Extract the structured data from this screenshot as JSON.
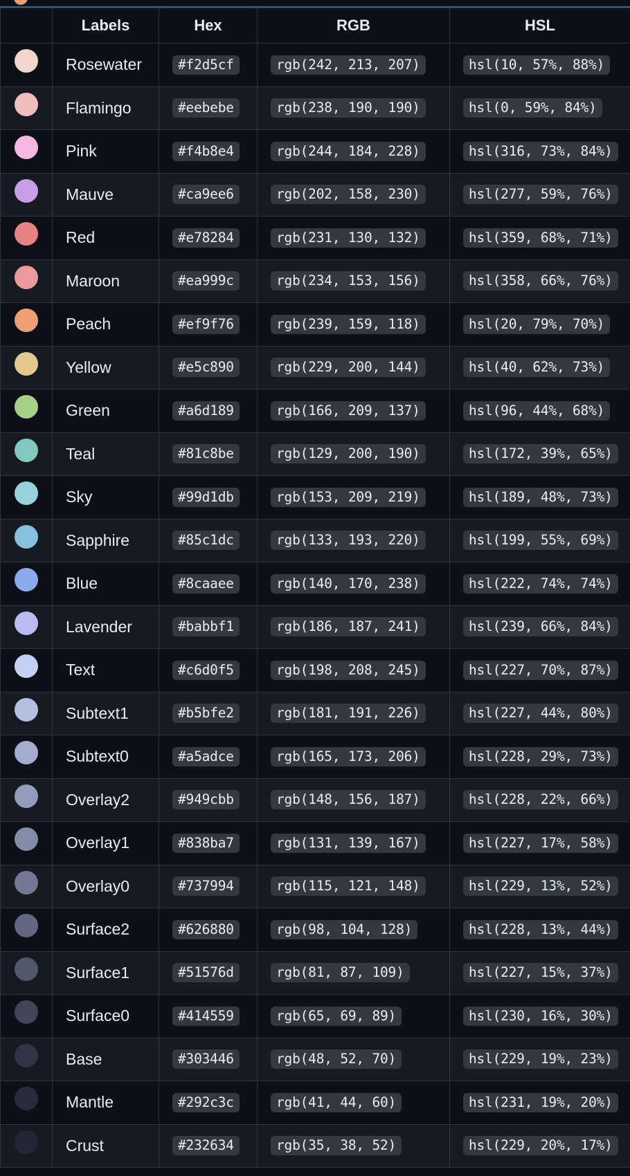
{
  "table": {
    "headers": {
      "swatch": "",
      "labels": "Labels",
      "hex": "Hex",
      "rgb": "RGB",
      "hsl": "HSL"
    },
    "rows": [
      {
        "label": "Rosewater",
        "hex": "#f2d5cf",
        "rgb": "rgb(242, 213, 207)",
        "hsl": "hsl(10, 57%, 88%)"
      },
      {
        "label": "Flamingo",
        "hex": "#eebebe",
        "rgb": "rgb(238, 190, 190)",
        "hsl": "hsl(0, 59%, 84%)"
      },
      {
        "label": "Pink",
        "hex": "#f4b8e4",
        "rgb": "rgb(244, 184, 228)",
        "hsl": "hsl(316, 73%, 84%)"
      },
      {
        "label": "Mauve",
        "hex": "#ca9ee6",
        "rgb": "rgb(202, 158, 230)",
        "hsl": "hsl(277, 59%, 76%)"
      },
      {
        "label": "Red",
        "hex": "#e78284",
        "rgb": "rgb(231, 130, 132)",
        "hsl": "hsl(359, 68%, 71%)"
      },
      {
        "label": "Maroon",
        "hex": "#ea999c",
        "rgb": "rgb(234, 153, 156)",
        "hsl": "hsl(358, 66%, 76%)"
      },
      {
        "label": "Peach",
        "hex": "#ef9f76",
        "rgb": "rgb(239, 159, 118)",
        "hsl": "hsl(20, 79%, 70%)"
      },
      {
        "label": "Yellow",
        "hex": "#e5c890",
        "rgb": "rgb(229, 200, 144)",
        "hsl": "hsl(40, 62%, 73%)"
      },
      {
        "label": "Green",
        "hex": "#a6d189",
        "rgb": "rgb(166, 209, 137)",
        "hsl": "hsl(96, 44%, 68%)"
      },
      {
        "label": "Teal",
        "hex": "#81c8be",
        "rgb": "rgb(129, 200, 190)",
        "hsl": "hsl(172, 39%, 65%)"
      },
      {
        "label": "Sky",
        "hex": "#99d1db",
        "rgb": "rgb(153, 209, 219)",
        "hsl": "hsl(189, 48%, 73%)"
      },
      {
        "label": "Sapphire",
        "hex": "#85c1dc",
        "rgb": "rgb(133, 193, 220)",
        "hsl": "hsl(199, 55%, 69%)"
      },
      {
        "label": "Blue",
        "hex": "#8caaee",
        "rgb": "rgb(140, 170, 238)",
        "hsl": "hsl(222, 74%, 74%)"
      },
      {
        "label": "Lavender",
        "hex": "#babbf1",
        "rgb": "rgb(186, 187, 241)",
        "hsl": "hsl(239, 66%, 84%)"
      },
      {
        "label": "Text",
        "hex": "#c6d0f5",
        "rgb": "rgb(198, 208, 245)",
        "hsl": "hsl(227, 70%, 87%)"
      },
      {
        "label": "Subtext1",
        "hex": "#b5bfe2",
        "rgb": "rgb(181, 191, 226)",
        "hsl": "hsl(227, 44%, 80%)"
      },
      {
        "label": "Subtext0",
        "hex": "#a5adce",
        "rgb": "rgb(165, 173, 206)",
        "hsl": "hsl(228, 29%, 73%)"
      },
      {
        "label": "Overlay2",
        "hex": "#949cbb",
        "rgb": "rgb(148, 156, 187)",
        "hsl": "hsl(228, 22%, 66%)"
      },
      {
        "label": "Overlay1",
        "hex": "#838ba7",
        "rgb": "rgb(131, 139, 167)",
        "hsl": "hsl(227, 17%, 58%)"
      },
      {
        "label": "Overlay0",
        "hex": "#737994",
        "rgb": "rgb(115, 121, 148)",
        "hsl": "hsl(229, 13%, 52%)"
      },
      {
        "label": "Surface2",
        "hex": "#626880",
        "rgb": "rgb(98, 104, 128)",
        "hsl": "hsl(228, 13%, 44%)"
      },
      {
        "label": "Surface1",
        "hex": "#51576d",
        "rgb": "rgb(81, 87, 109)",
        "hsl": "hsl(227, 15%, 37%)"
      },
      {
        "label": "Surface0",
        "hex": "#414559",
        "rgb": "rgb(65, 69, 89)",
        "hsl": "hsl(230, 16%, 30%)"
      },
      {
        "label": "Base",
        "hex": "#303446",
        "rgb": "rgb(48, 52, 70)",
        "hsl": "hsl(229, 19%, 23%)"
      },
      {
        "label": "Mantle",
        "hex": "#292c3c",
        "rgb": "rgb(41, 44, 60)",
        "hsl": "hsl(231, 19%, 20%)"
      },
      {
        "label": "Crust",
        "hex": "#232634",
        "rgb": "rgb(35, 38, 52)",
        "hsl": "hsl(229, 20%, 17%)"
      }
    ]
  },
  "theme": {
    "background": "#0d1117",
    "row_alt_background": "#161b22",
    "border": "#30363d",
    "code_background": "#343941",
    "text": "#e6edf3",
    "top_strip_swatch": "#ef9f76"
  }
}
